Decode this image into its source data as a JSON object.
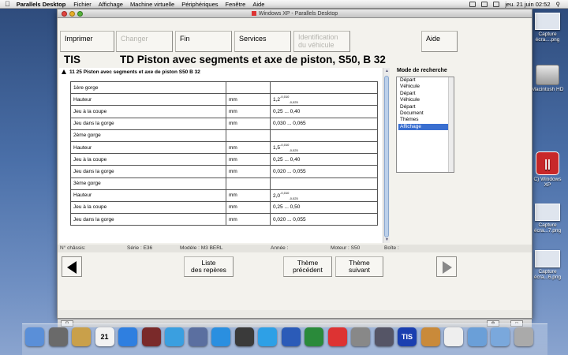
{
  "menubar": {
    "app": "Parallels Desktop",
    "items": [
      "Fichier",
      "Affichage",
      "Machine virtuelle",
      "Périphériques",
      "Fenêtre",
      "Aide"
    ],
    "clock": "jeu. 21 juin  02:52"
  },
  "desktop_icons": [
    {
      "label": "Capture écra....png"
    },
    {
      "label": "Macintosh HD"
    },
    {
      "label": "C) Windows XP"
    },
    {
      "label": "Capture écra...7.png"
    },
    {
      "label": "Capture écra...6.png"
    }
  ],
  "window": {
    "title": "Windows XP - Parallels Desktop"
  },
  "toolbar": {
    "imprimer": "Imprimer",
    "changer": "Changer",
    "fin": "Fin",
    "services": "Services",
    "identification_1": "Identification",
    "identification_2": "du véhicule",
    "aide": "Aide"
  },
  "header": {
    "tis": "TIS",
    "title": "TD  Piston avec segments et axe de piston, S50, B 32"
  },
  "section_title": "11 25 Piston avec segments et axe de piston S50  B 32",
  "table": {
    "rows": [
      {
        "label": "1ère gorge",
        "unit": "",
        "value": ""
      },
      {
        "label": "Hauteur",
        "unit": "mm",
        "value": "1,2",
        "tol_up": "-0,010",
        "tol_dn": "-0,025"
      },
      {
        "label": "Jeu à la coupe",
        "unit": "mm",
        "value": "0,25 ... 0,40"
      },
      {
        "label": "Jeu dans la gorge",
        "unit": "mm",
        "value": "0,030 ... 0,065"
      },
      {
        "label": "2ème gorge",
        "unit": "",
        "value": ""
      },
      {
        "label": "Hauteur",
        "unit": "mm",
        "value": "1,5",
        "tol_up": "-0,010",
        "tol_dn": "-0,025"
      },
      {
        "label": "Jeu à la coupe",
        "unit": "mm",
        "value": "0,25 ... 0,40"
      },
      {
        "label": "Jeu dans la gorge",
        "unit": "mm",
        "value": "0,020 ... 0,055"
      },
      {
        "label": "3ème gorge",
        "unit": "",
        "value": ""
      },
      {
        "label": "Hauteur",
        "unit": "mm",
        "value": "2,0",
        "tol_up": "-0,010",
        "tol_dn": "-0,025"
      },
      {
        "label": "Jeu à la coupe",
        "unit": "mm",
        "value": "0,25 ... 0,50"
      },
      {
        "label": "Jeu dans la gorge",
        "unit": "mm",
        "value": "0,020 ... 0,055"
      }
    ]
  },
  "mode": {
    "label": "Mode de recherche",
    "items": [
      "Départ",
      "Véhicule",
      "Départ",
      "Véhicule",
      "Départ",
      "Document",
      "Thèmes",
      "Affichage"
    ],
    "selected": 7
  },
  "info": {
    "chassis": "N° châssis:",
    "serie": "Série : E36",
    "modele": "Modèle : M3 BERL",
    "annee": "Année :",
    "moteur": "Moteur : S50",
    "boite": "Boîte :"
  },
  "nav": {
    "liste_1": "Liste",
    "liste_2": "des repères",
    "prec_1": "Thème",
    "prec_2": "précédent",
    "suiv_1": "Thème",
    "suiv_2": "suivant"
  },
  "dock_icons": [
    "finder",
    "launchpad",
    "preview",
    "calendar",
    "app-store",
    "photo-booth",
    "itunes",
    "preview-2",
    "safari",
    "time-machine",
    "skype",
    "word",
    "excel",
    "parallels",
    "system-prefs",
    "trash-utility",
    "tis",
    "home",
    "textedit",
    "folder",
    "folder-2",
    "trash"
  ],
  "dock_calendar_day": "21",
  "dock_tis_label": "TIS"
}
